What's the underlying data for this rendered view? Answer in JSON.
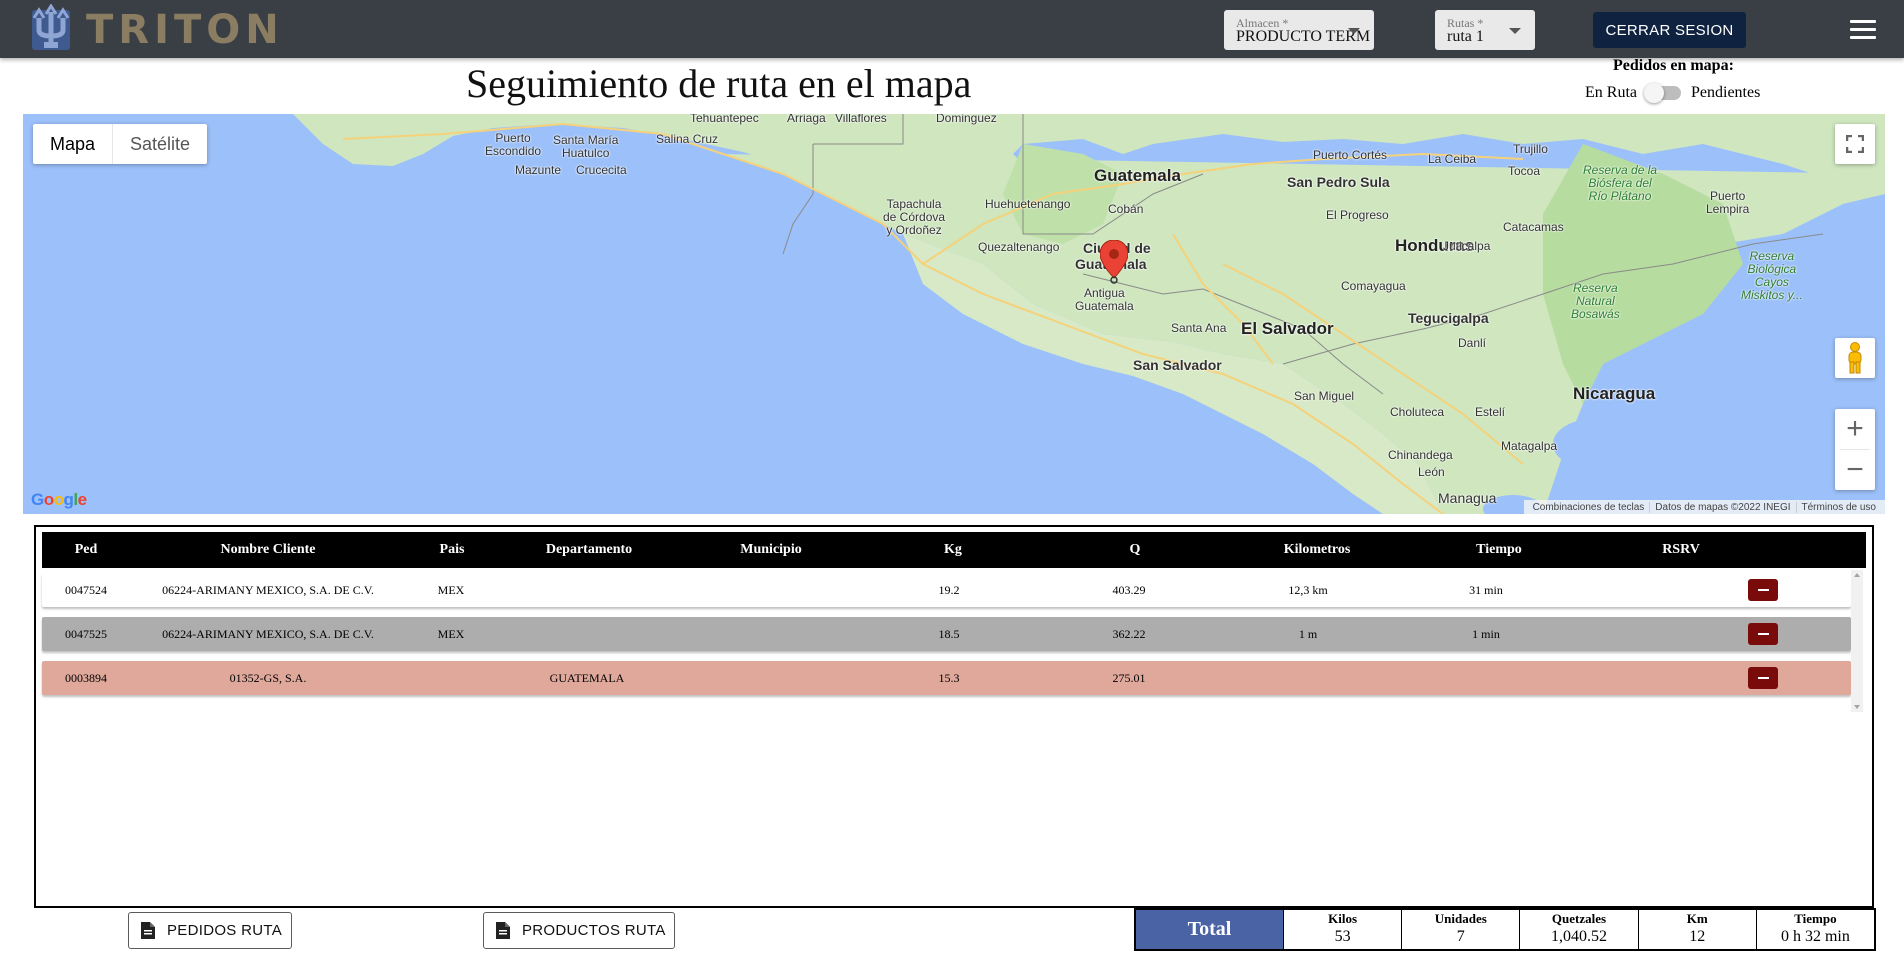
{
  "header": {
    "logo_text": "TRITON",
    "almacen": {
      "label": "Almacen *",
      "value": "PRODUCTO TERM"
    },
    "rutas": {
      "label": "Rutas *",
      "value": "ruta 1"
    },
    "logout_label": "CERRAR SESION"
  },
  "page": {
    "title": "Seguimiento de ruta en el mapa",
    "map_orders_title": "Pedidos en mapa:",
    "toggle_left": "En Ruta",
    "toggle_right": "Pendientes"
  },
  "map": {
    "type_map": "Mapa",
    "type_satellite": "Satélite",
    "attribution": {
      "shortcuts": "Combinaciones de teclas",
      "data": "Datos de mapas ©2022 INEGI",
      "terms": "Términos de uso"
    },
    "labels": {
      "guatemala": "Guatemala",
      "honduras": "Honduras",
      "el_salvador": "El Salvador",
      "nicaragua": "Nicaragua",
      "tegucigalpa": "Tegucigalpa",
      "san_salvador": "San Salvador",
      "san_pedro_sula": "San Pedro Sula",
      "ciudad_guatemala_1": "Ciudad de",
      "ciudad_guatemala_2": "Guatemala",
      "antigua": "Antigua\nGuatemala",
      "quetzaltenango": "Quezaltenango",
      "huehuetenango": "Huehuetenango",
      "coban": "Cobán",
      "tapachula": "Tapachula\nde Córdova\ny Ordoñez",
      "santa_ana": "Santa Ana",
      "san_miguel": "San Miguel",
      "choluteca": "Choluteca",
      "esteli": "Estelí",
      "chinandega": "Chinandega",
      "leon": "León",
      "managua": "Managua",
      "matagalpa": "Matagalpa",
      "danli": "Danlí",
      "comayagua": "Comayagua",
      "el_progreso": "El Progreso",
      "la_ceiba": "La Ceiba",
      "tocoa": "Tocoa",
      "trujillo": "Trujillo",
      "puerto_cortes": "Puerto Cortés",
      "juticalpa": "Juticalpa",
      "catacamas": "Catacamas",
      "puerto_lempira": "Puerto\nLempira",
      "puerto_escondido": "Puerto\nEscondido",
      "santa_maria_huatulco": "Santa María\nHuatulco",
      "salina_cruz": "Salina Cruz",
      "mazunte": "Mazunte",
      "crucecita": "Crucecita",
      "tehuantepec": "Tehuantepec",
      "arriaga": "Arriaga",
      "villaflores": "Villaflores",
      "dominguez": "Dominguez",
      "reserva_rio_platano": "Reserva de la\nBiósfera del\nRío Plátano",
      "reserva_bosawas": "Reserva\nNatural\nBosawás",
      "reserva_miskitos": "Reserva\nBiológica\nCayos\nMiskitos y..."
    }
  },
  "table": {
    "headers": [
      "Ped",
      "Nombre Cliente",
      "Pais",
      "Departamento",
      "Municipio",
      "Kg",
      "Q",
      "Kilometros",
      "Tiempo",
      "RSRV"
    ],
    "rows": [
      {
        "ped": "0047524",
        "cliente": "06224-ARIMANY MEXICO, S.A. DE C.V.",
        "pais": "MEX",
        "departamento": "",
        "municipio": "",
        "kg": "19.2",
        "q": "403.29",
        "km": "12,3 km",
        "tiempo": "31 min"
      },
      {
        "ped": "0047525",
        "cliente": "06224-ARIMANY MEXICO, S.A. DE C.V.",
        "pais": "MEX",
        "departamento": "",
        "municipio": "",
        "kg": "18.5",
        "q": "362.22",
        "km": "1 m",
        "tiempo": "1 min"
      },
      {
        "ped": "0003894",
        "cliente": "01352-GS, S.A.",
        "pais": "",
        "departamento": "GUATEMALA",
        "municipio": "",
        "kg": "15.3",
        "q": "275.01",
        "km": "",
        "tiempo": ""
      }
    ]
  },
  "footer": {
    "pedidos_label": "PEDIDOS RUTA",
    "productos_label": "PRODUCTOS RUTA"
  },
  "totals": {
    "label": "Total",
    "kilos_label": "Kilos",
    "kilos": "53",
    "unidades_label": "Unidades",
    "unidades": "7",
    "quetzales_label": "Quetzales",
    "quetzales": "1,040.52",
    "km_label": "Km",
    "km": "12",
    "tiempo_label": "Tiempo",
    "tiempo": "0 h 32 min"
  },
  "colors": {
    "topbar": "#3a3f46",
    "logo": "#8a7d62",
    "logout": "#0f2240",
    "total_label": "#4a63a4",
    "rsrv_button": "#7a0b0b",
    "row_gray": "#adadad",
    "row_pink": "#dfa89a",
    "water": "#9cc0f9",
    "land": "#cfe6bf"
  }
}
